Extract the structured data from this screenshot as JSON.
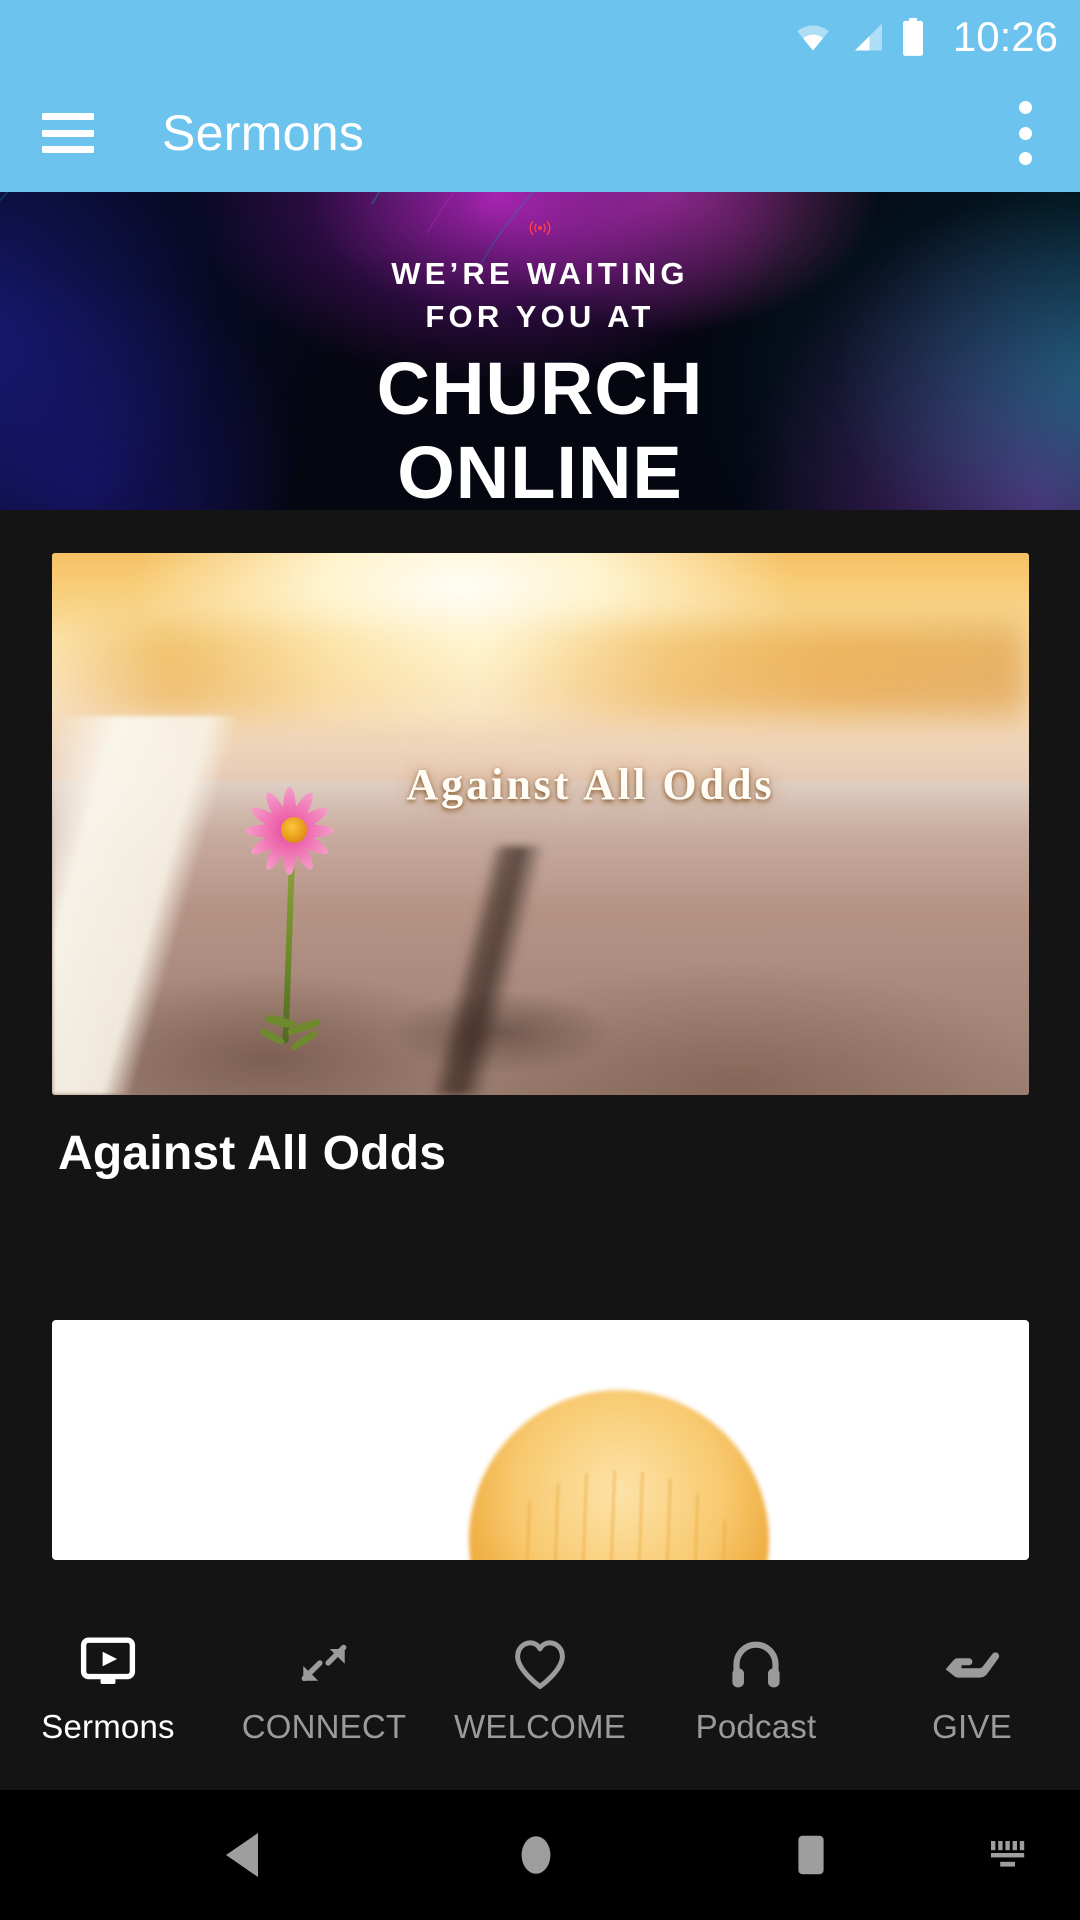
{
  "status_bar": {
    "time": "10:26",
    "icons": [
      "wifi-icon",
      "cellular-signal-icon",
      "battery-icon"
    ]
  },
  "app_bar": {
    "menu_icon": "hamburger-menu-icon",
    "title": "Sermons",
    "overflow_icon": "more-vertical-icon"
  },
  "promo_banner": {
    "broadcast_icon": "live-broadcast-icon",
    "line1": "WE’RE WAITING",
    "line2": "FOR YOU AT",
    "big_line1": "CHURCH",
    "big_line2": "ONLINE",
    "accent_color": "#ff3b4e",
    "bg_color": "#05060f",
    "text_color": "#ffffff"
  },
  "main": {
    "background_color": "#141414",
    "sermons": [
      {
        "overlay_title": "Against All Odds",
        "title": "Against All Odds",
        "thumbnail": "flower-in-road-crack-sunset-image"
      },
      {
        "overlay_title": "",
        "title": "",
        "thumbnail": "white-card-golden-glow-image"
      }
    ]
  },
  "bottom_nav": {
    "active_index": 0,
    "items": [
      {
        "label": "Sermons",
        "icon": "video-monitor-play-icon"
      },
      {
        "label": "CONNECT",
        "icon": "arrows-collapse-icon"
      },
      {
        "label": "WELCOME",
        "icon": "heart-outline-icon"
      },
      {
        "label": "Podcast",
        "icon": "headphones-icon"
      },
      {
        "label": "GIVE",
        "icon": "giving-hand-icon"
      }
    ],
    "active_color": "#ffffff",
    "inactive_color": "#9b9b9b"
  },
  "system_nav": {
    "items": [
      {
        "name": "back-button",
        "icon": "triangle-back-icon"
      },
      {
        "name": "home-button",
        "icon": "circle-home-icon"
      },
      {
        "name": "recents-button",
        "icon": "square-recents-icon"
      },
      {
        "name": "keyboard-button",
        "icon": "keyboard-icon"
      }
    ]
  },
  "theme": {
    "accent_blue": "#6cc3ee",
    "surface_dark": "#141414",
    "system_black": "#000000"
  }
}
